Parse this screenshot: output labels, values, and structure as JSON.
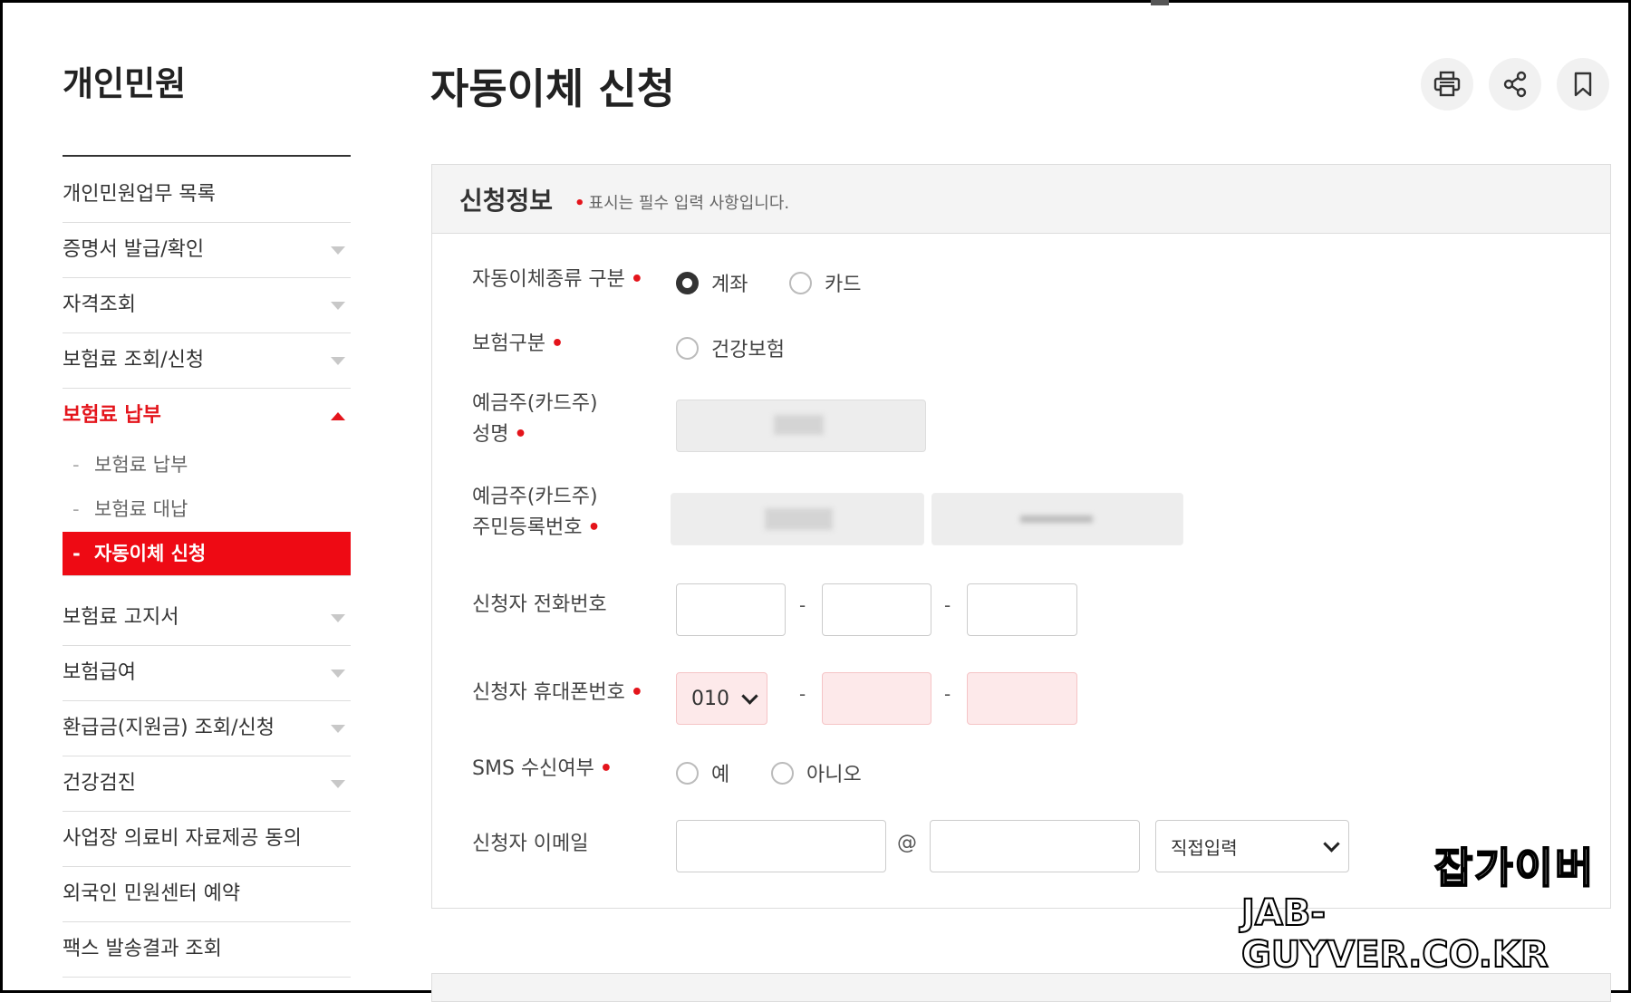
{
  "sidebar": {
    "title": "개인민원",
    "items": [
      {
        "label": "개인민원업무 목록"
      },
      {
        "label": "증명서 발급/확인"
      },
      {
        "label": "자격조회"
      },
      {
        "label": "보험료 조회/신청"
      },
      {
        "label": "보험료 납부"
      },
      {
        "label": "보험료 고지서"
      },
      {
        "label": "보험급여"
      },
      {
        "label": "환급금(지원금) 조회/신청"
      },
      {
        "label": "건강검진"
      },
      {
        "label": "사업장 의료비 자료제공 동의"
      },
      {
        "label": "외국인 민원센터 예약"
      },
      {
        "label": "팩스 발송결과 조회"
      }
    ],
    "sub_items": [
      {
        "label": "보험료 납부"
      },
      {
        "label": "보험료 대납"
      },
      {
        "label": "자동이체 신청"
      }
    ],
    "sub_dash": "-"
  },
  "page": {
    "title": "자동이체 신청"
  },
  "toolbar": {
    "icons": [
      "print-icon",
      "share-icon",
      "bookmark-icon"
    ]
  },
  "form": {
    "section_title": "신청정보",
    "required_dot": "•",
    "required_note": "표시는 필수 입력 사항입니다.",
    "transfer_type": {
      "label": "자동이체종류 구분",
      "options": [
        "계좌",
        "카드"
      ],
      "selected": "계좌"
    },
    "insurance_type": {
      "label": "보험구분",
      "options": [
        "건강보험"
      ]
    },
    "holder_name": {
      "label_line1": "예금주(카드주)",
      "label_line2": "성명"
    },
    "holder_rrn": {
      "label_line1": "예금주(카드주)",
      "label_line2": "주민등록번호"
    },
    "phone": {
      "label": "신청자 전화번호",
      "separator": "-"
    },
    "mobile": {
      "label": "신청자 휴대폰번호",
      "prefix": "010",
      "separator": "-"
    },
    "sms": {
      "label": "SMS 수신여부",
      "options": [
        "예",
        "아니오"
      ]
    },
    "email": {
      "label": "신청자 이메일",
      "at": "@",
      "domain_select": "직접입력"
    }
  },
  "watermark": {
    "line1": "잡가이버",
    "line2": "JAB-GUYVER.CO.KR"
  },
  "colors": {
    "accent": "#e4141b",
    "active_bg": "#ee0a14",
    "error_input_bg": "#fde9ea"
  }
}
